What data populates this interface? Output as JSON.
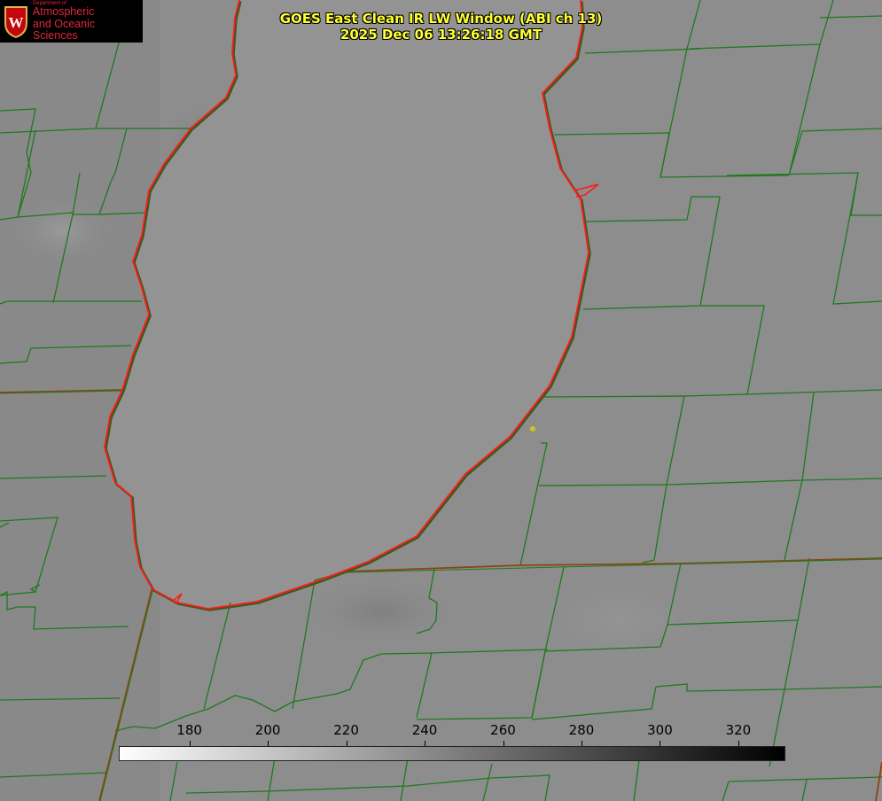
{
  "title_line1": "GOES East Clean IR LW Window (ABI ch 13)",
  "title_line2": "2025 Dec 06 13:26:18 GMT",
  "logo": {
    "department": "Department of",
    "line1": "Atmospheric",
    "line2": "and Oceanic Sciences",
    "icon": "uw-crest-icon"
  },
  "colorbar": {
    "ticks": [
      "180",
      "200",
      "220",
      "240",
      "260",
      "280",
      "300",
      "320"
    ],
    "tick_values": [
      180,
      200,
      220,
      240,
      260,
      280,
      300,
      320
    ],
    "range": [
      162,
      332
    ],
    "colormap": "white-to-black grayscale"
  },
  "colors": {
    "county_lines": "#1e7a1e",
    "state_lines": "#8b4513",
    "lake_shoreline": "#ff1a1a",
    "marker": "#d4c21c",
    "title": "#ffff33"
  }
}
